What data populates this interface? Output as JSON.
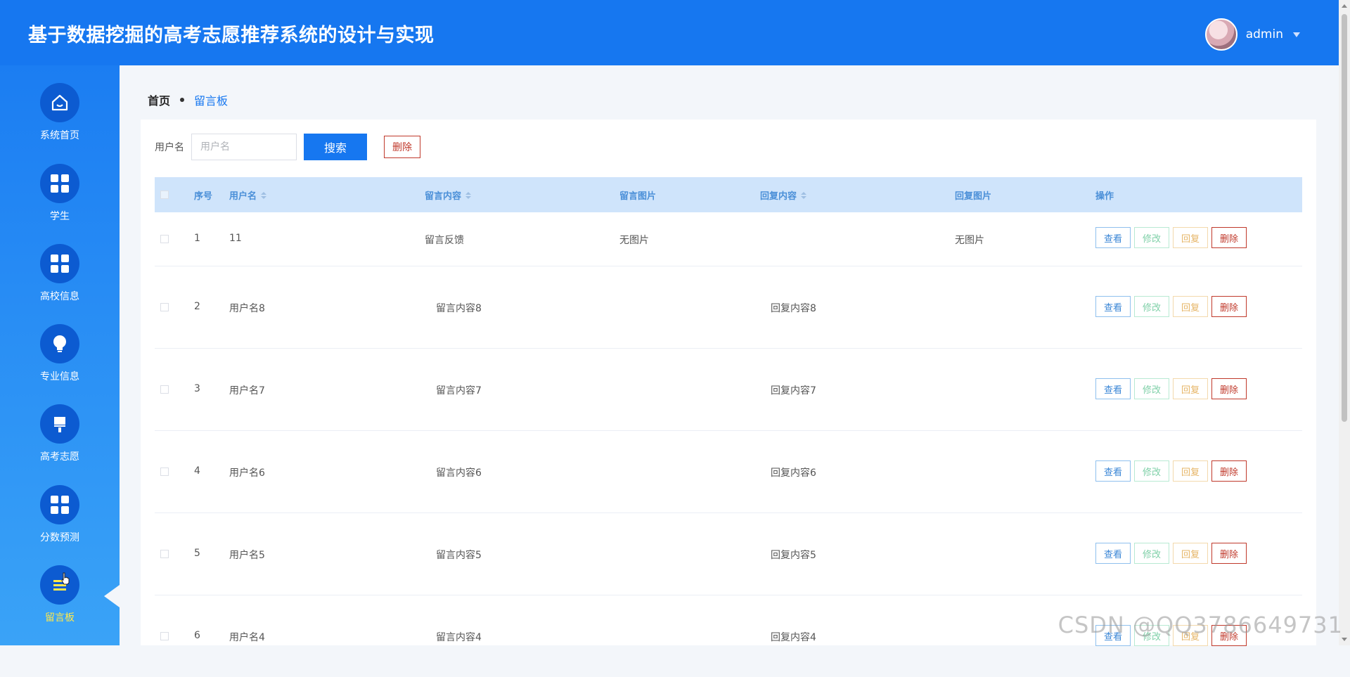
{
  "header": {
    "title": "基于数据挖掘的高考志愿推荐系统的设计与实现",
    "username": "admin"
  },
  "sidebar": {
    "items": [
      {
        "label": "系统首页",
        "icon": "home-icon"
      },
      {
        "label": "学生",
        "icon": "grid-icon"
      },
      {
        "label": "高校信息",
        "icon": "grid-icon"
      },
      {
        "label": "专业信息",
        "icon": "lightbulb-icon"
      },
      {
        "label": "高考志愿",
        "icon": "brush-icon"
      },
      {
        "label": "分数预测",
        "icon": "grid-icon"
      },
      {
        "label": "留言板",
        "icon": "message-board-icon"
      }
    ],
    "active_color": "#ffe94a"
  },
  "breadcrumb": {
    "home": "首页",
    "current": "留言板"
  },
  "search": {
    "label": "用户名",
    "placeholder": "用户名",
    "search_button": "搜索",
    "delete_button": "删除"
  },
  "table": {
    "headers": {
      "index": "序号",
      "username": "用户名",
      "content": "留言内容",
      "image": "留言图片",
      "reply": "回复内容",
      "reply_image": "回复图片",
      "actions": "操作"
    },
    "rows": [
      {
        "index": "1",
        "username": "11",
        "content": "留言反馈",
        "image": "无图片",
        "reply": "",
        "reply_image": "无图片"
      },
      {
        "index": "2",
        "username": "用户名8",
        "content": "留言内容8",
        "image": "",
        "reply": "回复内容8",
        "reply_image": ""
      },
      {
        "index": "3",
        "username": "用户名7",
        "content": "留言内容7",
        "image": "",
        "reply": "回复内容7",
        "reply_image": ""
      },
      {
        "index": "4",
        "username": "用户名6",
        "content": "留言内容6",
        "image": "",
        "reply": "回复内容6",
        "reply_image": ""
      },
      {
        "index": "5",
        "username": "用户名5",
        "content": "留言内容5",
        "image": "",
        "reply": "回复内容5",
        "reply_image": ""
      },
      {
        "index": "6",
        "username": "用户名4",
        "content": "留言内容4",
        "image": "",
        "reply": "回复内容4",
        "reply_image": ""
      }
    ],
    "actions": {
      "view": "查看",
      "edit": "修改",
      "reply": "回复",
      "delete": "删除"
    }
  },
  "watermark": "CSDN @QQ3786649731",
  "colors": {
    "primary": "#1677f0",
    "danger": "#c0392b",
    "header_bg": "#cfe4fb"
  }
}
